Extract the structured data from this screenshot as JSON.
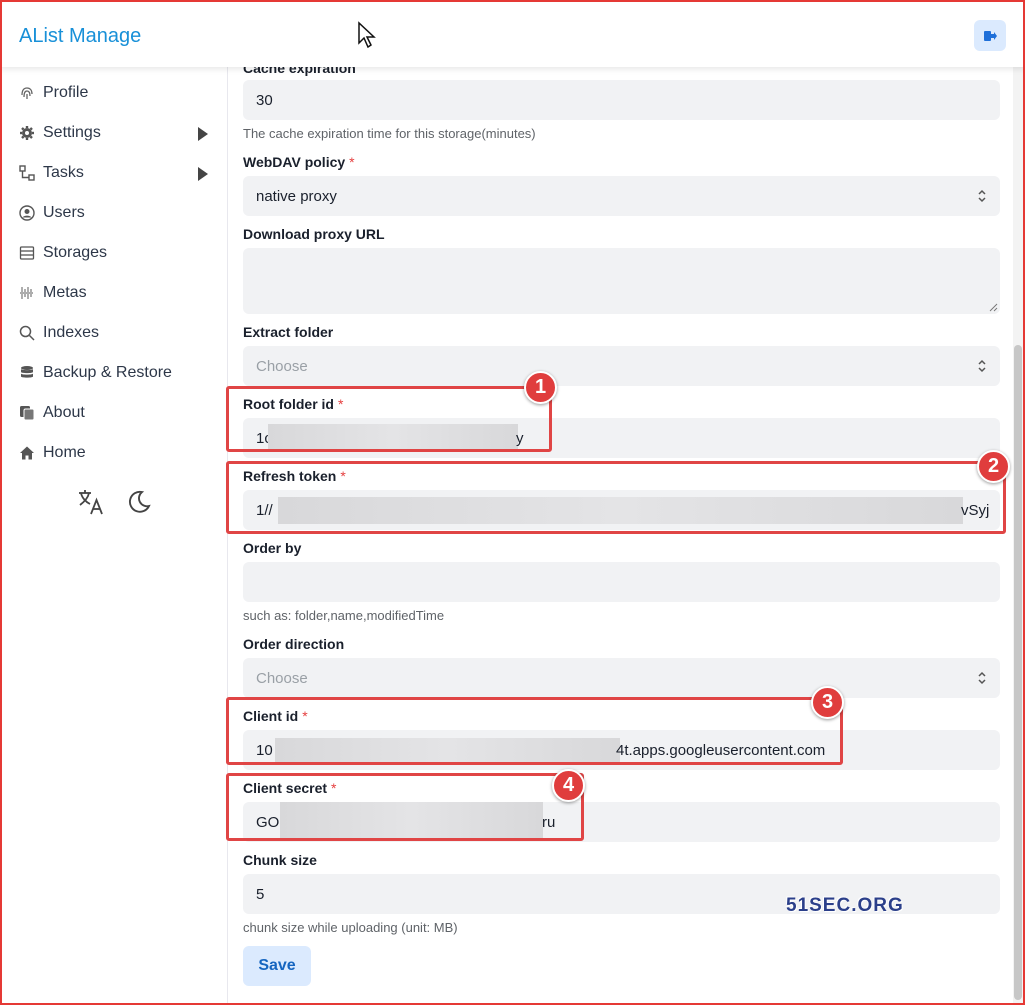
{
  "header": {
    "brand": "AList Manage",
    "logout_icon": "logout-icon"
  },
  "sidebar": {
    "items": [
      {
        "label": "Profile",
        "icon": "fingerprint-icon"
      },
      {
        "label": "Settings",
        "icon": "gear-icon",
        "expandable": true
      },
      {
        "label": "Tasks",
        "icon": "tasks-icon",
        "expandable": true
      },
      {
        "label": "Users",
        "icon": "user-circle-icon"
      },
      {
        "label": "Storages",
        "icon": "storage-icon"
      },
      {
        "label": "Metas",
        "icon": "metas-icon"
      },
      {
        "label": "Indexes",
        "icon": "search-icon"
      },
      {
        "label": "Backup & Restore",
        "icon": "database-icon"
      },
      {
        "label": "About",
        "icon": "copy-icon"
      },
      {
        "label": "Home",
        "icon": "home-icon"
      }
    ],
    "tools": [
      "translate-icon",
      "moon-icon"
    ]
  },
  "form": {
    "cache_expiration": {
      "label": "Cache expiration",
      "value": "30",
      "help": "The cache expiration time for this storage(minutes)"
    },
    "webdav_policy": {
      "label": "WebDAV policy",
      "required": "*",
      "value": "native proxy"
    },
    "download_proxy_url": {
      "label": "Download proxy URL",
      "value": ""
    },
    "extract_folder": {
      "label": "Extract folder",
      "placeholder": "Choose"
    },
    "root_folder_id": {
      "label": "Root folder id",
      "required": "*",
      "value_start": "1c",
      "value_end": "y"
    },
    "refresh_token": {
      "label": "Refresh token",
      "required": "*",
      "value_start": "1//",
      "value_end": "vSyj"
    },
    "order_by": {
      "label": "Order by",
      "value": "",
      "help": "such as: folder,name,modifiedTime"
    },
    "order_direction": {
      "label": "Order direction",
      "placeholder": "Choose"
    },
    "client_id": {
      "label": "Client id",
      "required": "*",
      "value_start": "10",
      "value_end": "4t.apps.googleusercontent.com"
    },
    "client_secret": {
      "label": "Client secret",
      "required": "*",
      "value_start": "GO",
      "value_end": "ru"
    },
    "chunk_size": {
      "label": "Chunk size",
      "value": "5",
      "help": "chunk size while uploading (unit: MB)"
    },
    "save_label": "Save"
  },
  "annotations": [
    "1",
    "2",
    "3",
    "4"
  ],
  "watermark": "51SEC.ORG",
  "colors": {
    "accent": "#1890d8",
    "annotation": "#e04545",
    "required": "#e53e3e",
    "field_bg": "#f1f2f4"
  }
}
